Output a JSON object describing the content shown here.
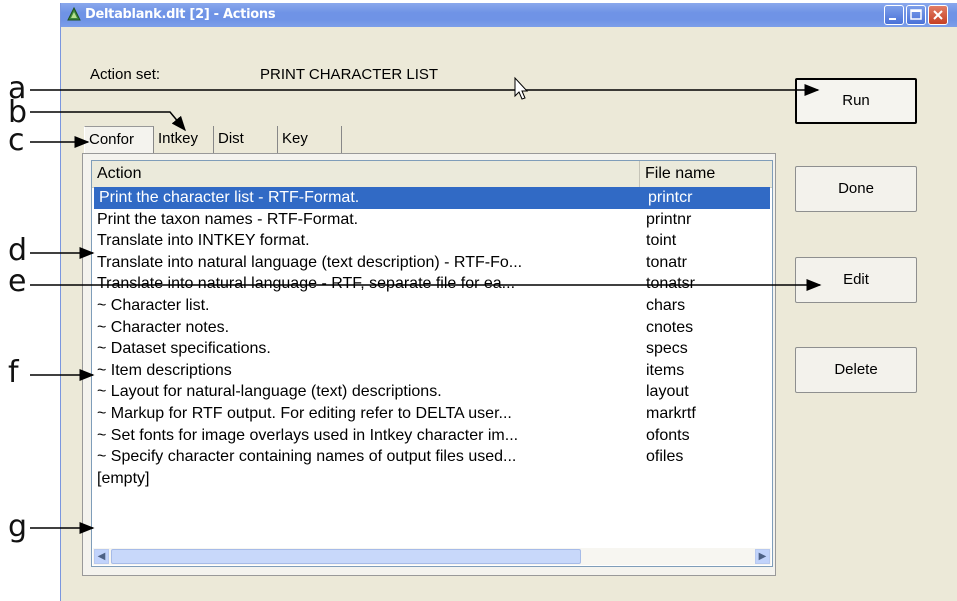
{
  "window": {
    "title": "Deltablank.dlt [2] - Actions"
  },
  "action_set": {
    "label": "Action set:",
    "value": "PRINT CHARACTER LIST"
  },
  "buttons": {
    "run": "Run",
    "done": "Done",
    "edit": "Edit",
    "delete": "Delete"
  },
  "tabs": [
    "Confor",
    "Intkey",
    "Dist",
    "Key"
  ],
  "list": {
    "columns": [
      "Action",
      "File name"
    ],
    "rows": [
      {
        "action": "Print the character list - RTF-Format.",
        "file": "printcr"
      },
      {
        "action": "Print the taxon names - RTF-Format.",
        "file": "printnr"
      },
      {
        "action": "Translate into INTKEY format.",
        "file": "toint"
      },
      {
        "action": "Translate into natural language (text description) - RTF-Fo...",
        "file": "tonatr"
      },
      {
        "action": "Translate into natural language - RTF, separate file for ea...",
        "file": "tonatsr"
      },
      {
        "action": "~ Character list.",
        "file": "chars"
      },
      {
        "action": "~ Character notes.",
        "file": "cnotes"
      },
      {
        "action": "~ Dataset specifications.",
        "file": "specs"
      },
      {
        "action": "~ Item descriptions",
        "file": "items"
      },
      {
        "action": "~ Layout for natural-language (text) descriptions.",
        "file": "layout"
      },
      {
        "action": "~ Markup for RTF output. For editing refer to DELTA user...",
        "file": "markrtf"
      },
      {
        "action": "~ Set fonts for image overlays used in Intkey character im...",
        "file": "ofonts"
      },
      {
        "action": "~ Specify character containing names of output files used...",
        "file": "ofiles"
      },
      {
        "action": "[empty]",
        "file": ""
      }
    ]
  },
  "callouts": [
    "a",
    "b",
    "c",
    "d",
    "e",
    "f",
    "g"
  ],
  "colors": {
    "selection": "#316ac5",
    "titlebar": "#6f93e6",
    "window_bg": "#ece9d8"
  }
}
